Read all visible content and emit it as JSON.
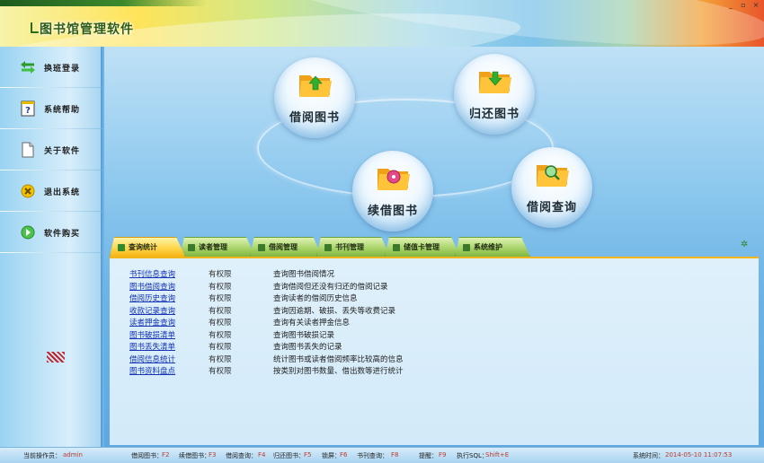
{
  "header": {
    "title": "图书馆管理软件",
    "window_controls": [
      "_",
      "▫",
      "×"
    ]
  },
  "sidebar": {
    "items": [
      {
        "label": "换班登录",
        "icon": "swap-arrows-icon"
      },
      {
        "label": "系统帮助",
        "icon": "help-icon"
      },
      {
        "label": "关于软件",
        "icon": "document-icon"
      },
      {
        "label": "退出系统",
        "icon": "exit-icon"
      },
      {
        "label": "软件购买",
        "icon": "purchase-icon"
      }
    ]
  },
  "bubbles": [
    {
      "label": "借阅图书",
      "icon": "folder-up-arrow-icon"
    },
    {
      "label": "归还图书",
      "icon": "folder-down-arrow-icon"
    },
    {
      "label": "续借图书",
      "icon": "folder-disc-icon"
    },
    {
      "label": "借阅查询",
      "icon": "folder-search-icon"
    }
  ],
  "tabs": [
    {
      "label": "查询统计",
      "active": true
    },
    {
      "label": "读者管理",
      "active": false
    },
    {
      "label": "借阅管理",
      "active": false
    },
    {
      "label": "书刊管理",
      "active": false
    },
    {
      "label": "储值卡管理",
      "active": false
    },
    {
      "label": "系统维护",
      "active": false
    }
  ],
  "rows": [
    {
      "name": "书刊信息查询",
      "perm": "有权限",
      "desc": "查询图书借阅情况"
    },
    {
      "name": "图书借阅查询",
      "perm": "有权限",
      "desc": "查询借阅但还没有归还的借阅记录"
    },
    {
      "name": "借阅历史查询",
      "perm": "有权限",
      "desc": "查询读者的借阅历史信息"
    },
    {
      "name": "收款记录查询",
      "perm": "有权限",
      "desc": "查询因逾期、破损、丢失等收费记录"
    },
    {
      "name": "读者押金查询",
      "perm": "有权限",
      "desc": "查询有关读者押金信息"
    },
    {
      "name": "图书破损清单",
      "perm": "有权限",
      "desc": "查询图书破损记录"
    },
    {
      "name": "图书丢失清单",
      "perm": "有权限",
      "desc": "查询图书丢失的记录"
    },
    {
      "name": "借阅信息统计",
      "perm": "有权限",
      "desc": "统计图书或读者借阅频率比较高的信息"
    },
    {
      "name": "图书资料盘点",
      "perm": "有权限",
      "desc": "按类别对图书数量、借出数等进行统计"
    }
  ],
  "status": {
    "operator_label": "当前操作员：",
    "operator": "admin",
    "shortcuts": [
      {
        "label": "借阅图书：",
        "key": "F2"
      },
      {
        "label": "续借图书：",
        "key": "F3"
      },
      {
        "label": "借阅查询：",
        "key": "F4"
      },
      {
        "label": "归还图书：",
        "key": "F5"
      },
      {
        "label": "锁屏：",
        "key": "F6"
      },
      {
        "label": "书刊查询：",
        "key": "F8"
      },
      {
        "label": "提醒：",
        "key": "F9"
      },
      {
        "label": "执行SQL：",
        "key": "Shift+E"
      }
    ],
    "time_label": "系统时间：",
    "time": "2014-05-10  11:07:53"
  },
  "colors": {
    "link": "#1433b8",
    "active_tab": "#ffd54a",
    "tab": "#a9d46a",
    "status_key": "#c0392b"
  }
}
